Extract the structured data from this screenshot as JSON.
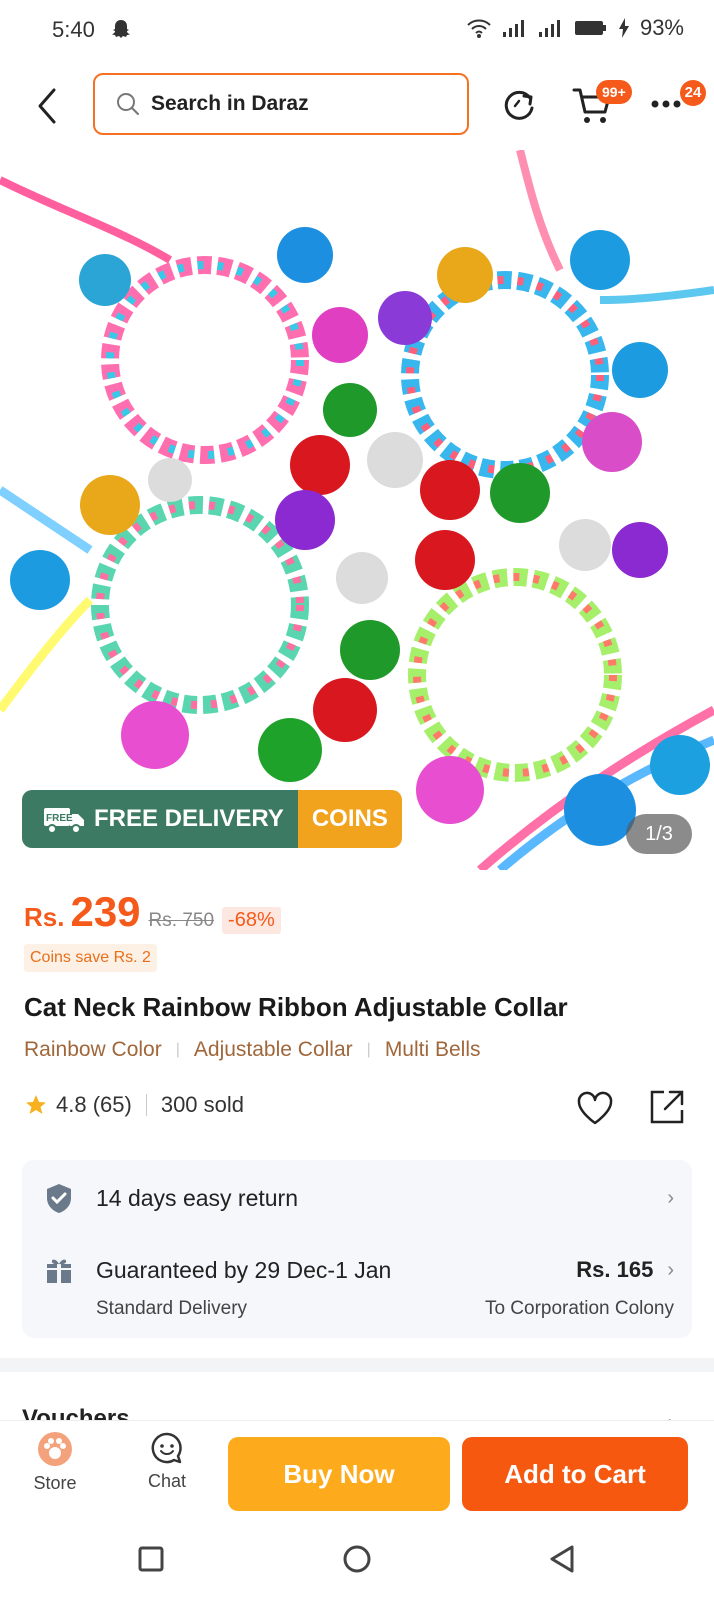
{
  "status_bar": {
    "time": "5:40",
    "battery": "93%"
  },
  "top_bar": {
    "search_placeholder": "Search in Daraz",
    "cart_badge": "99+",
    "more_badge": "24"
  },
  "product_image": {
    "free_delivery_label": "FREE DELIVERY",
    "free_truck_text": "FREE",
    "coins_label": "COINS",
    "counter": "1/3"
  },
  "price": {
    "currency": "Rs.",
    "current": "239",
    "original": "Rs. 750",
    "discount": "-68%",
    "coins_save": "Coins save Rs. 2"
  },
  "product": {
    "title": "Cat Neck Rainbow Ribbon Adjustable Collar",
    "tags": [
      "Rainbow Color",
      "Adjustable Collar",
      "Multi Bells"
    ],
    "rating": "4.8 (65)",
    "sold": "300 sold"
  },
  "services": {
    "return_policy": "14 days easy return",
    "delivery_guarantee": "Guaranteed by 29 Dec-1 Jan",
    "delivery_fee": "Rs. 165",
    "delivery_type": "Standard Delivery",
    "delivery_location": "To Corporation Colony"
  },
  "vouchers": {
    "title": "Vouchers"
  },
  "action_bar": {
    "store_label": "Store",
    "chat_label": "Chat",
    "buy_now_label": "Buy Now",
    "add_to_cart_label": "Add to Cart"
  },
  "colors": {
    "brand_orange": "#f57224",
    "buy_now": "#fdab1d",
    "add_to_cart": "#f7580f",
    "free_delivery_green": "#3d7a63",
    "coins_yellow": "#f2a31e"
  }
}
